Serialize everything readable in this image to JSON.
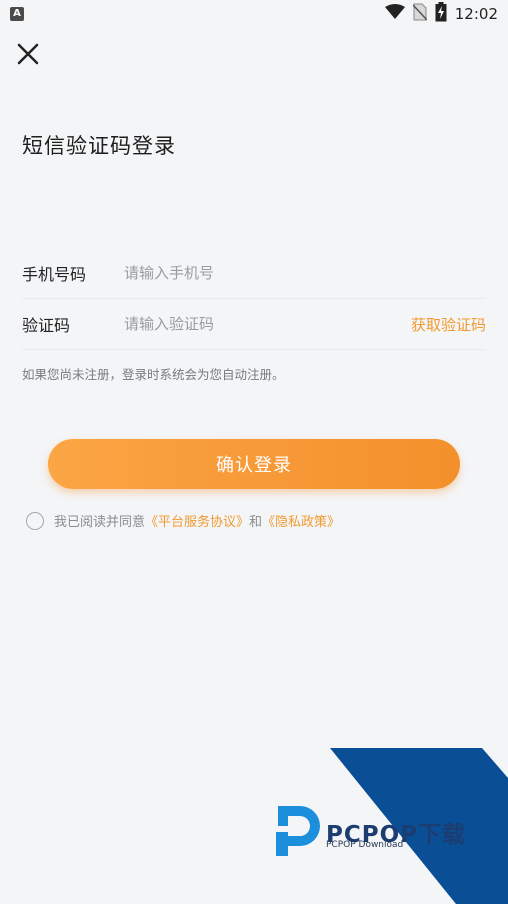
{
  "status_bar": {
    "app_badge": "A",
    "time": "12:02"
  },
  "title": "短信验证码登录",
  "form": {
    "phone_label": "手机号码",
    "phone_placeholder": "请输入手机号",
    "code_label": "验证码",
    "code_placeholder": "请输入验证码",
    "get_code": "获取验证码"
  },
  "hint": "如果您尚未注册，登录时系统会为您自动注册。",
  "submit": "确认登录",
  "agreement": {
    "prefix": "我已阅读并同意",
    "link1": "《平台服务协议》",
    "conj": "和",
    "link2": "《隐私政策》"
  },
  "watermark": {
    "brand": "PCPOP下载",
    "sub": "PCPOP Download"
  },
  "colors": {
    "accent": "#f29a30",
    "button_start": "#fba544",
    "button_end": "#f3902c",
    "watermark_blue": "#0a4f96"
  }
}
